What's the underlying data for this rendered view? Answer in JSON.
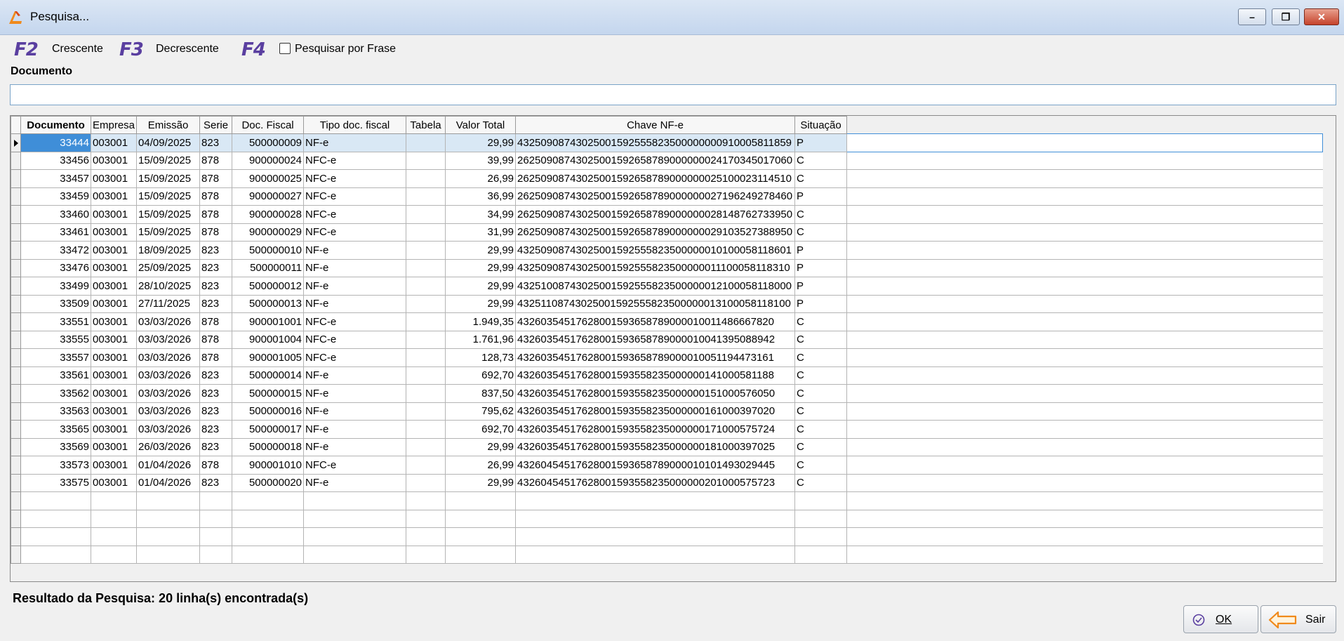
{
  "window": {
    "title": "Pesquisa..."
  },
  "toolbar": {
    "f2": {
      "key": "F2",
      "label": "Crescente"
    },
    "f3": {
      "key": "F3",
      "label": "Decrescente"
    },
    "f4": {
      "key": "F4",
      "label": "Pesquisar por Frase",
      "checked": false
    }
  },
  "search": {
    "label": "Documento",
    "value": ""
  },
  "grid": {
    "columns": [
      "Documento",
      "Empresa",
      "Emissão",
      "Serie",
      "Doc. Fiscal",
      "Tipo doc. fiscal",
      "Tabela",
      "Valor Total",
      "Chave NF-e",
      "Situação"
    ],
    "selected_index": 0,
    "rows": [
      {
        "documento": "33444",
        "empresa": "003001",
        "emissao": "04/09/2025",
        "serie": "823",
        "doc_fiscal": "500000009",
        "tipo": "NF-e",
        "tabela": "",
        "valor": "29,99",
        "chave": "43250908743025001592555823500000000910005811859",
        "situacao": "P"
      },
      {
        "documento": "33456",
        "empresa": "003001",
        "emissao": "15/09/2025",
        "serie": "878",
        "doc_fiscal": "900000024",
        "tipo": "NFC-e",
        "tabela": "",
        "valor": "39,99",
        "chave": "26250908743025001592658789000000024170345017060",
        "situacao": "C"
      },
      {
        "documento": "33457",
        "empresa": "003001",
        "emissao": "15/09/2025",
        "serie": "878",
        "doc_fiscal": "900000025",
        "tipo": "NFC-e",
        "tabela": "",
        "valor": "26,99",
        "chave": "26250908743025001592658789000000025100023114510",
        "situacao": "C"
      },
      {
        "documento": "33459",
        "empresa": "003001",
        "emissao": "15/09/2025",
        "serie": "878",
        "doc_fiscal": "900000027",
        "tipo": "NFC-e",
        "tabela": "",
        "valor": "36,99",
        "chave": "26250908743025001592658789000000027196249278460",
        "situacao": "P"
      },
      {
        "documento": "33460",
        "empresa": "003001",
        "emissao": "15/09/2025",
        "serie": "878",
        "doc_fiscal": "900000028",
        "tipo": "NFC-e",
        "tabela": "",
        "valor": "34,99",
        "chave": "26250908743025001592658789000000028148762733950",
        "situacao": "C"
      },
      {
        "documento": "33461",
        "empresa": "003001",
        "emissao": "15/09/2025",
        "serie": "878",
        "doc_fiscal": "900000029",
        "tipo": "NFC-e",
        "tabela": "",
        "valor": "31,99",
        "chave": "26250908743025001592658789000000029103527388950",
        "situacao": "C"
      },
      {
        "documento": "33472",
        "empresa": "003001",
        "emissao": "18/09/2025",
        "serie": "823",
        "doc_fiscal": "500000010",
        "tipo": "NF-e",
        "tabela": "",
        "valor": "29,99",
        "chave": "43250908743025001592555823500000010100058118601",
        "situacao": "P"
      },
      {
        "documento": "33476",
        "empresa": "003001",
        "emissao": "25/09/2025",
        "serie": "823",
        "doc_fiscal": "500000011",
        "tipo": "NF-e",
        "tabela": "",
        "valor": "29,99",
        "chave": "43250908743025001592555823500000011100058118310",
        "situacao": "P"
      },
      {
        "documento": "33499",
        "empresa": "003001",
        "emissao": "28/10/2025",
        "serie": "823",
        "doc_fiscal": "500000012",
        "tipo": "NF-e",
        "tabela": "",
        "valor": "29,99",
        "chave": "43251008743025001592555823500000012100058118000",
        "situacao": "P"
      },
      {
        "documento": "33509",
        "empresa": "003001",
        "emissao": "27/11/2025",
        "serie": "823",
        "doc_fiscal": "500000013",
        "tipo": "NF-e",
        "tabela": "",
        "valor": "29,99",
        "chave": "43251108743025001592555823500000013100058118100",
        "situacao": "P"
      },
      {
        "documento": "33551",
        "empresa": "003001",
        "emissao": "03/03/2026",
        "serie": "878",
        "doc_fiscal": "900001001",
        "tipo": "NFC-e",
        "tabela": "",
        "valor": "1.949,35",
        "chave": "43260354517628001593658789000010011486667820",
        "situacao": "C"
      },
      {
        "documento": "33555",
        "empresa": "003001",
        "emissao": "03/03/2026",
        "serie": "878",
        "doc_fiscal": "900001004",
        "tipo": "NFC-e",
        "tabela": "",
        "valor": "1.761,96",
        "chave": "43260354517628001593658789000010041395088942",
        "situacao": "C"
      },
      {
        "documento": "33557",
        "empresa": "003001",
        "emissao": "03/03/2026",
        "serie": "878",
        "doc_fiscal": "900001005",
        "tipo": "NFC-e",
        "tabela": "",
        "valor": "128,73",
        "chave": "43260354517628001593658789000010051194473161",
        "situacao": "C"
      },
      {
        "documento": "33561",
        "empresa": "003001",
        "emissao": "03/03/2026",
        "serie": "823",
        "doc_fiscal": "500000014",
        "tipo": "NF-e",
        "tabela": "",
        "valor": "692,70",
        "chave": "43260354517628001593558235000000141000581188",
        "situacao": "C"
      },
      {
        "documento": "33562",
        "empresa": "003001",
        "emissao": "03/03/2026",
        "serie": "823",
        "doc_fiscal": "500000015",
        "tipo": "NF-e",
        "tabela": "",
        "valor": "837,50",
        "chave": "43260354517628001593558235000000151000576050",
        "situacao": "C"
      },
      {
        "documento": "33563",
        "empresa": "003001",
        "emissao": "03/03/2026",
        "serie": "823",
        "doc_fiscal": "500000016",
        "tipo": "NF-e",
        "tabela": "",
        "valor": "795,62",
        "chave": "43260354517628001593558235000000161000397020",
        "situacao": "C"
      },
      {
        "documento": "33565",
        "empresa": "003001",
        "emissao": "03/03/2026",
        "serie": "823",
        "doc_fiscal": "500000017",
        "tipo": "NF-e",
        "tabela": "",
        "valor": "692,70",
        "chave": "43260354517628001593558235000000171000575724",
        "situacao": "C"
      },
      {
        "documento": "33569",
        "empresa": "003001",
        "emissao": "26/03/2026",
        "serie": "823",
        "doc_fiscal": "500000018",
        "tipo": "NF-e",
        "tabela": "",
        "valor": "29,99",
        "chave": "43260354517628001593558235000000181000397025",
        "situacao": "C"
      },
      {
        "documento": "33573",
        "empresa": "003001",
        "emissao": "01/04/2026",
        "serie": "878",
        "doc_fiscal": "900001010",
        "tipo": "NFC-e",
        "tabela": "",
        "valor": "26,99",
        "chave": "43260454517628001593658789000010101493029445",
        "situacao": "C"
      },
      {
        "documento": "33575",
        "empresa": "003001",
        "emissao": "01/04/2026",
        "serie": "823",
        "doc_fiscal": "500000020",
        "tipo": "NF-e",
        "tabela": "",
        "valor": "29,99",
        "chave": "43260454517628001593558235000000201000575723",
        "situacao": "C"
      }
    ],
    "empty_rows": 4
  },
  "status": {
    "result_text": "Resultado da Pesquisa: 20 linha(s) encontrada(s)"
  },
  "buttons": {
    "ok": "OK",
    "sair": "Sair"
  },
  "colors": {
    "selection": "#3f8ed8",
    "brand_accent": "#5a3fa0",
    "icon_orange": "#f08a1c"
  }
}
